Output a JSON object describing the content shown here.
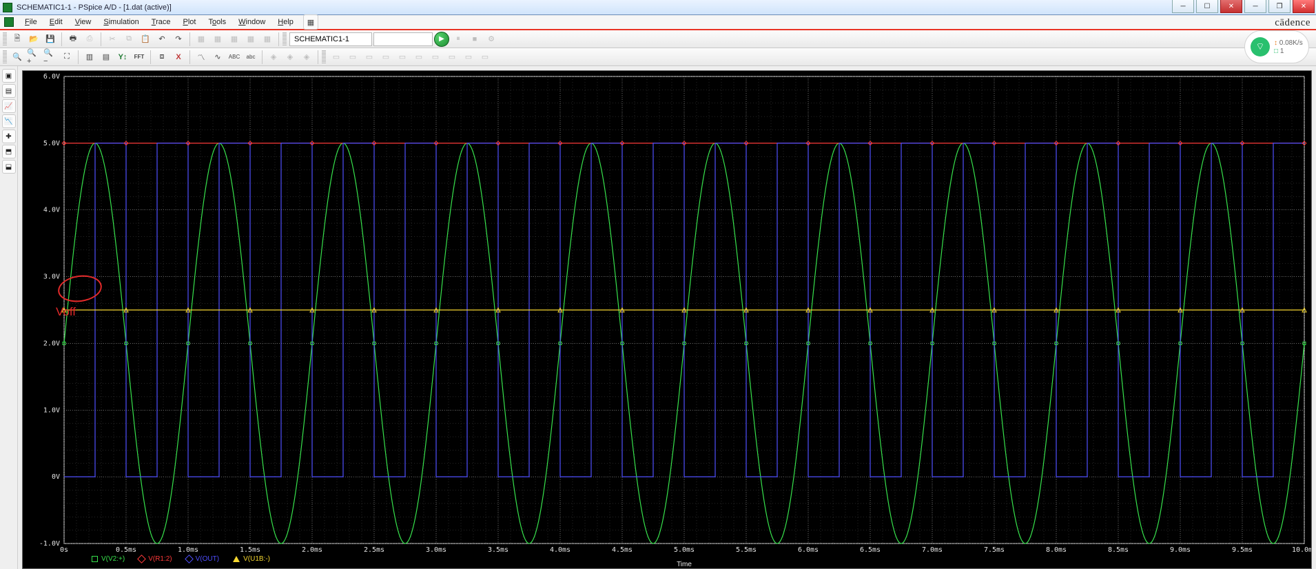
{
  "window": {
    "title": "SCHEMATIC1-1 - PSpice A/D  - [1.dat (active)]",
    "brand": "cādence"
  },
  "menu": {
    "file": "File",
    "edit": "Edit",
    "view": "View",
    "simulation": "Simulation",
    "trace": "Trace",
    "plot": "Plot",
    "tools": "Tools",
    "window": "Window",
    "help": "Help"
  },
  "toolbar1": {
    "schematic_name": "SCHEMATIC1-1"
  },
  "net": {
    "rate": "0.08K/s",
    "count": "1"
  },
  "annotation": "Voff",
  "legend": {
    "t1": "V(V2:+)",
    "t2": "V(R1:2)",
    "t3": "V(OUT)",
    "t4": "V(U1B:-)"
  },
  "axis": {
    "xlabel": "Time"
  },
  "chart_data": {
    "type": "line",
    "title": "",
    "xlabel": "Time",
    "ylabel": "",
    "xlim_ms": [
      0,
      10
    ],
    "ylim_v": [
      -1,
      6
    ],
    "xticks_ms": [
      0,
      0.5,
      1,
      1.5,
      2,
      2.5,
      3,
      3.5,
      4,
      4.5,
      5,
      5.5,
      6,
      6.5,
      7,
      7.5,
      8,
      8.5,
      9,
      9.5,
      10
    ],
    "xtick_labels": [
      "0s",
      "0.5ms",
      "1.0ms",
      "1.5ms",
      "2.0ms",
      "2.5ms",
      "3.0ms",
      "3.5ms",
      "4.0ms",
      "4.5ms",
      "5.0ms",
      "5.5ms",
      "6.0ms",
      "6.5ms",
      "7.0ms",
      "7.5ms",
      "8.0ms",
      "8.5ms",
      "9.0ms",
      "9.5ms",
      "10.0ms"
    ],
    "yticks_v": [
      -1,
      0,
      1,
      2,
      3,
      4,
      5,
      6
    ],
    "ytick_labels": [
      "-1.0V",
      "0V",
      "1.0V",
      "2.0V",
      "3.0V",
      "4.0V",
      "5.0V",
      "6.0V"
    ],
    "series": [
      {
        "name": "V(V2:+)",
        "color": "#37e24c",
        "description": "sine wave, offset 2.0 V, amplitude 3.0 V, frequency 1 kHz -> 10 periods over 10 ms",
        "analytic": {
          "type": "sine",
          "offset_v": 2.0,
          "amplitude_v": 3.0,
          "freq_hz": 1000,
          "phase_deg": 0
        }
      },
      {
        "name": "V(R1:2)",
        "color": "#ff3a3a",
        "description": "constant 5.0 V (supply rail)",
        "analytic": {
          "type": "const",
          "value_v": 5.0
        }
      },
      {
        "name": "V(OUT)",
        "color": "#4f4fff",
        "description": "periodic rectangular wave 0 V / 5 V, high for ~50% of each 0.5 ms half-period, aligned with zero-crossings of sine about 2.5 V threshold (inverting comparator output, 2 pulses per ms)",
        "square": {
          "low_v": 0.0,
          "high_v": 5.0,
          "period_ms": 0.5,
          "duty": 0.5,
          "phase_ms": 0.0
        }
      },
      {
        "name": "V(U1B:-)",
        "color": "#f5d730",
        "description": "constant ~2.5 V (comparator threshold)",
        "analytic": {
          "type": "const",
          "value_v": 2.5
        }
      }
    ],
    "annotation": {
      "text": "Voff",
      "at_v": 2.0,
      "at_ms": 0,
      "style": "red-circle"
    }
  }
}
